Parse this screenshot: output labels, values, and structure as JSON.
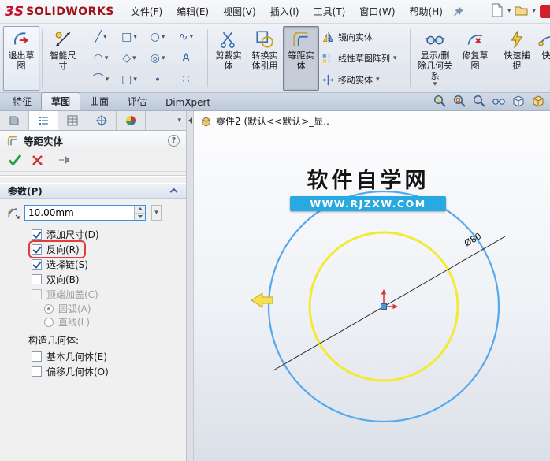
{
  "menubar": {
    "logo_mark": "3S",
    "logo_text": "SOLIDWORKS",
    "menus": [
      "文件(F)",
      "编辑(E)",
      "视图(V)",
      "插入(I)",
      "工具(T)",
      "窗口(W)",
      "帮助(H)"
    ]
  },
  "ribbon": {
    "exit_sketch": "退出草图",
    "smart_dimension": "智能尺寸",
    "trim_entities": "剪裁实体",
    "convert_entities": "转换实体引用",
    "offset_entities": "等距实体",
    "mirror_entities": "镜向实体",
    "linear_sketch_pattern": "线性草图阵列",
    "move_entities": "移动实体",
    "display_delete_relations": "显示/删除几何关系",
    "repair_sketch": "修复草图",
    "quick_snaps": "快速捕捉",
    "clipped_label": "快"
  },
  "tabs": [
    "特征",
    "草图",
    "曲面",
    "评估",
    "DimXpert"
  ],
  "pm": {
    "title": "等距实体",
    "help": "?",
    "params_header": "参数(P)",
    "distance": "10.00mm",
    "add_dimensions": "添加尺寸(D)",
    "reverse": "反向(R)",
    "select_chain": "选择链(S)",
    "bidirectional": "双向(B)",
    "cap_ends": "顶端加盖(C)",
    "arcs": "圆弧(A)",
    "lines": "直线(L)",
    "construction": "构造几何体:",
    "base_geometry": "基本几何体(E)",
    "offset_geometry": "偏移几何体(O)"
  },
  "viewport": {
    "tree_item": "零件2 (默认<<默认>_显..",
    "watermark_title": "软件自学网",
    "watermark_url": "WWW.RJZXW.COM",
    "dimension": "Ø80"
  },
  "icons": {
    "caret": "▾",
    "sketch_tools": [
      "╱",
      "□",
      "○",
      "∿",
      "◠",
      "◇",
      "◎",
      "A",
      "⌒",
      "▢",
      "∙",
      "∷"
    ]
  },
  "colors": {
    "circle_blue": "#55a8ec",
    "circle_yellow": "#f3ea33",
    "origin_red": "#e03030",
    "watermark_bar": "#29a9e2",
    "annotation_red": "#e23c3c",
    "logo_red": "#c8102e"
  }
}
